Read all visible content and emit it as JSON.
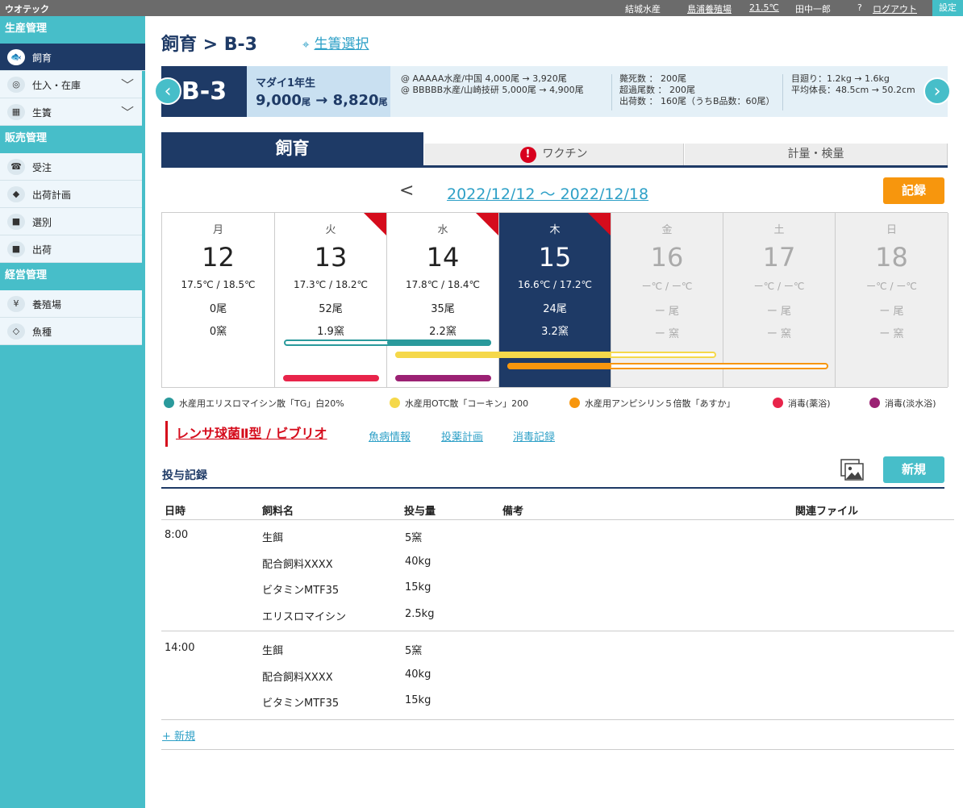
{
  "topbar": {
    "brand": "ウオテック",
    "company": "結城水産",
    "farm": "島浦養殖場",
    "temperature": "21.5℃",
    "user": "田中一郎",
    "help": "?",
    "logout": "ログアウト",
    "settings": "設定"
  },
  "sidebar": {
    "sections": [
      {
        "title": "生産管理",
        "items": [
          {
            "label": "飼育",
            "icon": "fish-feed-icon",
            "active": true
          },
          {
            "label": "仕入・在庫",
            "icon": "bag-icon",
            "expandable": true
          },
          {
            "label": "生簀",
            "icon": "map-icon",
            "expandable": true
          }
        ]
      },
      {
        "title": "販売管理",
        "items": [
          {
            "label": "受注",
            "icon": "phone-icon"
          },
          {
            "label": "出荷計画",
            "icon": "fish-icon"
          },
          {
            "label": "選別",
            "icon": "truck-icon"
          },
          {
            "label": "出荷",
            "icon": "truck-icon"
          }
        ]
      },
      {
        "title": "経営管理",
        "items": [
          {
            "label": "養殖場",
            "icon": "money-icon"
          },
          {
            "label": "魚種",
            "icon": "fish-outline-icon"
          }
        ]
      }
    ]
  },
  "page": {
    "title": "飼育 > B-3",
    "cage_select": "生簀選択"
  },
  "info": {
    "code": "B-3",
    "species": "マダイ1年生",
    "count_from": "9,000",
    "count_to": "8,820",
    "count_unit": "尾",
    "arrow": "→",
    "sources": [
      "@ AAAAA水産/中国  4,000尾  →  3,920尾",
      "@ BBBBB水産/山崎技研  5,000尾  →  4,900尾"
    ],
    "stats": [
      "斃死数 ： 200尾",
      "超過尾数 ： 200尾",
      "出荷数 ： 160尾（うちB品数：60尾）"
    ],
    "growth": [
      "目廻り：1.2kg → 1.6kg",
      "平均体長：48.5cm → 50.2cm"
    ]
  },
  "tabs": [
    {
      "label": "飼育",
      "active": true
    },
    {
      "label": "ワクチン",
      "warning": true
    },
    {
      "label": "計量・検量"
    }
  ],
  "week": {
    "prev": "<",
    "range": "2022/12/12 ～ 2022/12/18",
    "record_button": "記録",
    "days": [
      {
        "wd": "月",
        "date": "12",
        "temp": "17.5℃ / 18.5℃",
        "count": "0尾",
        "amount": "0窯",
        "state": "past",
        "flag": false
      },
      {
        "wd": "火",
        "date": "13",
        "temp": "17.3℃ / 18.2℃",
        "count": "52尾",
        "amount": "1.9窯",
        "state": "past",
        "flag": true
      },
      {
        "wd": "水",
        "date": "14",
        "temp": "17.8℃ / 18.4℃",
        "count": "35尾",
        "amount": "2.2窯",
        "state": "past",
        "flag": true
      },
      {
        "wd": "木",
        "date": "15",
        "temp": "16.6℃ / 17.2℃",
        "count": "24尾",
        "amount": "3.2窯",
        "state": "selected",
        "flag": true
      },
      {
        "wd": "金",
        "date": "16",
        "temp": "ー℃ / ー℃",
        "count": "ー 尾",
        "amount": "ー 窯",
        "state": "future",
        "flag": false
      },
      {
        "wd": "土",
        "date": "17",
        "temp": "ー℃ / ー℃",
        "count": "ー 尾",
        "amount": "ー 窯",
        "state": "future",
        "flag": false
      },
      {
        "wd": "日",
        "date": "18",
        "temp": "ー℃ / ー℃",
        "count": "ー 尾",
        "amount": "ー 窯",
        "state": "future",
        "flag": false
      }
    ]
  },
  "medicines": [
    {
      "label": "水産用エリスロマイシン散「TG」白20%",
      "color": "#2a9a9c"
    },
    {
      "label": "水産用OTC散「コーキン」200",
      "color": "#f5d84a"
    },
    {
      "label": "水産用アンピシリン５倍散「あすか」",
      "color": "#f7960d"
    },
    {
      "label": "消毒(薬浴)",
      "color": "#e8244a"
    },
    {
      "label": "消毒(淡水浴)",
      "color": "#9b2173"
    }
  ],
  "disease": {
    "name": "レンサ球菌Ⅱ型 / ビブリオ",
    "links": [
      "魚病情報",
      "投薬計画",
      "消毒記録"
    ]
  },
  "records": {
    "title": "投与記録",
    "new_button": "新規",
    "columns": [
      "日時",
      "飼料名",
      "投与量",
      "備考",
      "関連ファイル"
    ],
    "groups": [
      {
        "time": "8:00",
        "rows": [
          {
            "feed": "生餌",
            "amount": "5窯"
          },
          {
            "feed": "配合飼料XXXX",
            "amount": "40kg"
          },
          {
            "feed": "ビタミンMTF35",
            "amount": "15kg"
          },
          {
            "feed": "エリスロマイシン",
            "amount": "2.5kg"
          }
        ]
      },
      {
        "time": "14:00",
        "rows": [
          {
            "feed": "生餌",
            "amount": "5窯"
          },
          {
            "feed": "配合飼料XXXX",
            "amount": "40kg"
          },
          {
            "feed": "ビタミンMTF35",
            "amount": "15kg"
          }
        ]
      }
    ],
    "add_link": "+ 新規"
  }
}
